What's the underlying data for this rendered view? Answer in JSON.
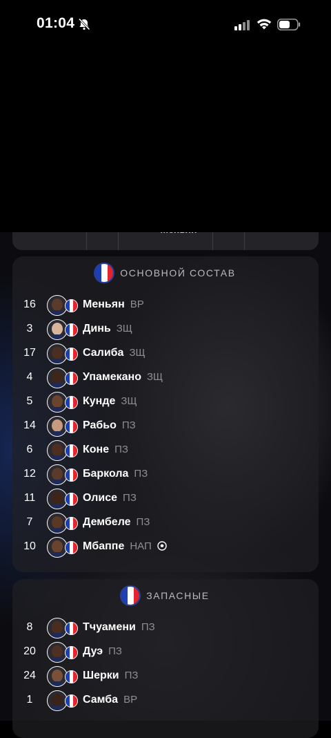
{
  "status_bar": {
    "time": "01:04"
  },
  "top_card": {
    "partial_name": "Меньян"
  },
  "colors": {
    "flag_blue": "#1f3fb0",
    "flag_white": "#ffffff",
    "flag_red": "#e3262d"
  },
  "starting": {
    "title": "ОСНОВНОЙ СОСТАВ",
    "players": [
      {
        "number": "16",
        "name": "Меньян",
        "pos": "ВР",
        "skin": "#5a3a2a"
      },
      {
        "number": "3",
        "name": "Динь",
        "pos": "ЗЩ",
        "skin": "#d8b49a"
      },
      {
        "number": "17",
        "name": "Салиба",
        "pos": "ЗЩ",
        "skin": "#4a2e22"
      },
      {
        "number": "4",
        "name": "Упамекано",
        "pos": "ЗЩ",
        "skin": "#3e2619"
      },
      {
        "number": "5",
        "name": "Кунде",
        "pos": "ЗЩ",
        "skin": "#6b4430"
      },
      {
        "number": "14",
        "name": "Рабьо",
        "pos": "ПЗ",
        "skin": "#c99b7e"
      },
      {
        "number": "6",
        "name": "Коне",
        "pos": "ПЗ",
        "skin": "#4c2f20"
      },
      {
        "number": "12",
        "name": "Баркола",
        "pos": "ПЗ",
        "skin": "#5b3a29"
      },
      {
        "number": "11",
        "name": "Олисе",
        "pos": "ПЗ",
        "skin": "#3f2519"
      },
      {
        "number": "7",
        "name": "Дембеле",
        "pos": "ПЗ",
        "skin": "#5a3826"
      },
      {
        "number": "10",
        "name": "Мбаппе",
        "pos": "НАП",
        "skin": "#6a432e",
        "captain": true
      }
    ]
  },
  "subs": {
    "title": "ЗАПАСНЫЕ",
    "players": [
      {
        "number": "8",
        "name": "Тчуамени",
        "pos": "ПЗ",
        "skin": "#4a2d1f"
      },
      {
        "number": "20",
        "name": "Дуэ",
        "pos": "ПЗ",
        "skin": "#4e3022"
      },
      {
        "number": "24",
        "name": "Шерки",
        "pos": "ПЗ",
        "skin": "#7a5038"
      },
      {
        "number": "1",
        "name": "Самба",
        "pos": "ВР",
        "skin": "#3a2318"
      }
    ]
  }
}
